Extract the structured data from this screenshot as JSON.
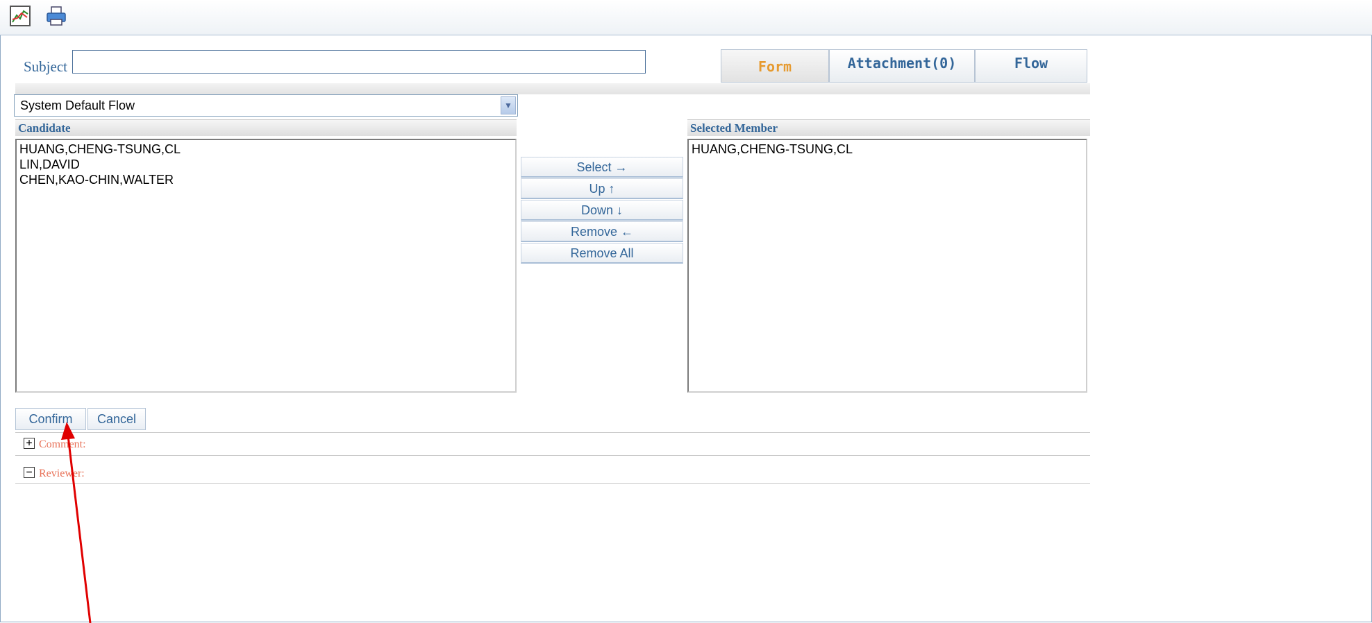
{
  "toolbar": {
    "icons": [
      "chart-icon",
      "printer-icon"
    ]
  },
  "subject": {
    "label": "Subject",
    "value": ""
  },
  "tabs": [
    {
      "label": "Form",
      "active": true
    },
    {
      "label": "Attachment(0)",
      "active": false
    },
    {
      "label": "Flow",
      "active": false
    }
  ],
  "flow_select": {
    "selected": "System Default Flow"
  },
  "candidate": {
    "header": "Candidate",
    "items": [
      "HUANG,CHENG-TSUNG,CL",
      "LIN,DAVID",
      "CHEN,KAO-CHIN,WALTER"
    ]
  },
  "selected": {
    "header": "Selected Member",
    "items": [
      "HUANG,CHENG-TSUNG,CL"
    ]
  },
  "actions": {
    "select": "Select →",
    "up": "Up ↑",
    "down": "Down ↓",
    "remove": "Remove ←",
    "remove_all": "Remove All"
  },
  "buttons": {
    "confirm": "Confirm",
    "cancel": "Cancel"
  },
  "sections": {
    "comment": {
      "label": "Comment:",
      "icon": "+"
    },
    "reviewer": {
      "label": "Reviewer:",
      "icon": "−"
    }
  },
  "colors": {
    "accent": "#336699",
    "active_tab": "#e69a2f",
    "section_label": "#e8735a",
    "annotation_arrow": "#e00000"
  }
}
